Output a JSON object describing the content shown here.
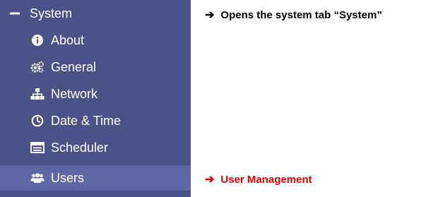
{
  "sidebar": {
    "header": {
      "label": "System",
      "icon": "minus-icon"
    },
    "items": [
      {
        "label": "About",
        "icon": "info-circle-icon"
      },
      {
        "label": "General",
        "icon": "gears-icon"
      },
      {
        "label": "Network",
        "icon": "sitemap-icon"
      },
      {
        "label": "Date & Time",
        "icon": "clock-icon"
      },
      {
        "label": "Scheduler",
        "icon": "calendar-list-icon"
      },
      {
        "label": "Users",
        "icon": "users-icon",
        "selected": true
      }
    ]
  },
  "annotations": [
    {
      "arrow": "➔",
      "text": "Opens the system tab “System”",
      "color": "#000000"
    },
    {
      "arrow": "➔",
      "text": "User Management",
      "color": "#e00000"
    }
  ],
  "colors": {
    "sidebar_bg": "#4a5287",
    "selected_bg": "#5e67a3",
    "text": "#ffffff",
    "annotation_red": "#e00000"
  }
}
